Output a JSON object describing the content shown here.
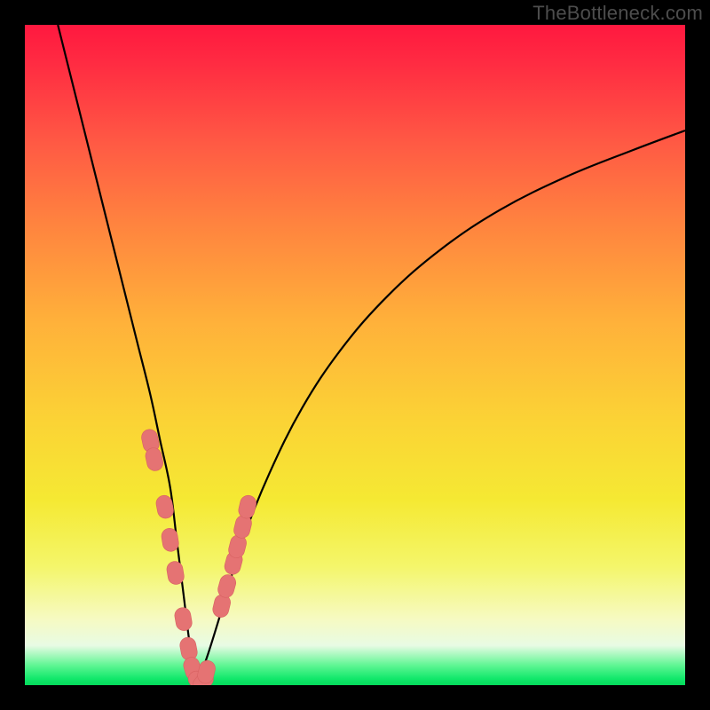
{
  "watermark": "TheBottleneck.com",
  "colors": {
    "background_frame": "#000000",
    "curve_stroke": "#000000",
    "marker_fill": "#e57373",
    "marker_stroke": "#d86262",
    "gradient_top": "#ff183f",
    "gradient_bottom": "#04d95a"
  },
  "chart_data": {
    "type": "line",
    "title": "",
    "xlabel": "",
    "ylabel": "",
    "xlim": [
      0,
      100
    ],
    "ylim": [
      0,
      100
    ],
    "grid": false,
    "legend": false,
    "annotations": [
      "TheBottleneck.com"
    ],
    "series": [
      {
        "name": "bottleneck-curve",
        "x": [
          5,
          7,
          9,
          11,
          13,
          15,
          17,
          19,
          20.5,
          22,
          23,
          24,
          25,
          26,
          27.5,
          30,
          33,
          37,
          42,
          48,
          55,
          63,
          72,
          82,
          92,
          100
        ],
        "y": [
          100,
          92,
          84,
          76,
          68,
          60,
          52,
          44,
          37,
          30,
          22,
          14,
          6,
          0.5,
          4,
          12,
          22,
          32,
          42,
          51,
          59,
          66,
          72,
          77,
          81,
          84
        ]
      }
    ],
    "markers": {
      "name": "highlighted-points",
      "x": [
        19.0,
        19.6,
        21.2,
        22.0,
        22.8,
        24.0,
        24.8,
        25.4,
        26.3,
        27.0,
        27.5,
        29.8,
        30.6,
        31.6,
        32.2,
        33.0,
        33.7
      ],
      "y": [
        37.0,
        34.2,
        27.0,
        22.0,
        17.0,
        10.0,
        5.5,
        2.5,
        0.5,
        0.5,
        2.0,
        12.0,
        15.0,
        18.5,
        21.0,
        24.0,
        27.0
      ]
    }
  }
}
